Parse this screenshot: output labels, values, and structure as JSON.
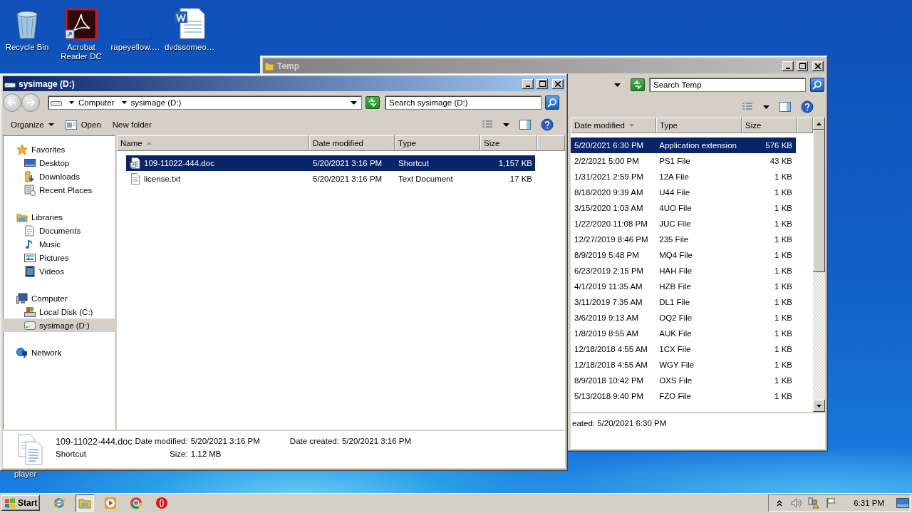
{
  "desktop": {
    "icons": [
      {
        "label": "Recycle Bin",
        "kind": "bin"
      },
      {
        "label": "Acrobat Reader DC",
        "kind": "acrobat"
      },
      {
        "label": "rapeyellow.…",
        "kind": "blank"
      },
      {
        "label": "dvdssomeo…",
        "kind": "word"
      }
    ],
    "covered_label": "player"
  },
  "temp_window": {
    "title": "Temp",
    "active": false,
    "search_placeholder": "Search Temp",
    "columns": [
      {
        "label": "Date modified",
        "sorted": true,
        "descending": true
      },
      {
        "label": "Type",
        "sorted": false
      },
      {
        "label": "Size",
        "sorted": false
      }
    ],
    "rows": [
      {
        "date": "5/20/2021 6:30 PM",
        "type": "Application extension",
        "size": "576 KB",
        "selected": true
      },
      {
        "date": "2/2/2021 5:00 PM",
        "type": "PS1 File",
        "size": "43 KB",
        "selected": false
      },
      {
        "date": "1/31/2021 2:59 PM",
        "type": "12A File",
        "size": "1 KB",
        "selected": false
      },
      {
        "date": "8/18/2020 9:39 AM",
        "type": "U44 File",
        "size": "1 KB",
        "selected": false
      },
      {
        "date": "3/15/2020 1:03 AM",
        "type": "4UO File",
        "size": "1 KB",
        "selected": false
      },
      {
        "date": "1/22/2020 11:08 PM",
        "type": "JUC File",
        "size": "1 KB",
        "selected": false
      },
      {
        "date": "12/27/2019 8:46 PM",
        "type": "235 File",
        "size": "1 KB",
        "selected": false
      },
      {
        "date": "8/9/2019 5:48 PM",
        "type": "MQ4 File",
        "size": "1 KB",
        "selected": false
      },
      {
        "date": "6/23/2019 2:15 PM",
        "type": "HAH File",
        "size": "1 KB",
        "selected": false
      },
      {
        "date": "4/1/2019 11:35 AM",
        "type": "HZB File",
        "size": "1 KB",
        "selected": false
      },
      {
        "date": "3/11/2019 7:35 AM",
        "type": "DL1 File",
        "size": "1 KB",
        "selected": false
      },
      {
        "date": "3/6/2019 9:13 AM",
        "type": "OQ2 File",
        "size": "1 KB",
        "selected": false
      },
      {
        "date": "1/8/2019 8:55 AM",
        "type": "AUK File",
        "size": "1 KB",
        "selected": false
      },
      {
        "date": "12/18/2018 4:55 AM",
        "type": "1CX File",
        "size": "1 KB",
        "selected": false
      },
      {
        "date": "12/18/2018 4:55 AM",
        "type": "WGY File",
        "size": "1 KB",
        "selected": false
      },
      {
        "date": "8/9/2018 10:42 PM",
        "type": "OXS File",
        "size": "1 KB",
        "selected": false
      },
      {
        "date": "5/13/2018 9:40 PM",
        "type": "FZO File",
        "size": "1 KB",
        "selected": false
      }
    ],
    "status": "eated: 5/20/2021 6:30 PM"
  },
  "explorer_window": {
    "title": "sysimage (D:)",
    "active": true,
    "breadcrumb": [
      "Computer",
      "sysimage (D:)"
    ],
    "search_placeholder": "Search sysimage (D:)",
    "commands": [
      {
        "label": "Organize",
        "kind": "menu"
      },
      {
        "label": "Open",
        "kind": "icon"
      },
      {
        "label": "New folder",
        "kind": "plain"
      }
    ],
    "nav": [
      {
        "label": "Favorites",
        "kind": "star",
        "selected": false,
        "children": [
          {
            "label": "Desktop",
            "kind": "desktop",
            "selected": false
          },
          {
            "label": "Downloads",
            "kind": "downloads",
            "selected": false
          },
          {
            "label": "Recent Places",
            "kind": "recent",
            "selected": false
          }
        ]
      },
      {
        "label": "Libraries",
        "kind": "libraries",
        "selected": false,
        "children": [
          {
            "label": "Documents",
            "kind": "documents",
            "selected": false
          },
          {
            "label": "Music",
            "kind": "music",
            "selected": false
          },
          {
            "label": "Pictures",
            "kind": "pictures",
            "selected": false
          },
          {
            "label": "Videos",
            "kind": "videos",
            "selected": false
          }
        ]
      },
      {
        "label": "Computer",
        "kind": "computer",
        "selected": false,
        "children": [
          {
            "label": "Local Disk (C:)",
            "kind": "localdisk",
            "selected": false
          },
          {
            "label": "sysimage (D:)",
            "kind": "drive",
            "selected": true
          }
        ]
      },
      {
        "label": "Network",
        "kind": "network",
        "selected": false
      }
    ],
    "columns": [
      {
        "label": "Name",
        "sorted": true,
        "descending": false
      },
      {
        "label": "Date modified",
        "sorted": false
      },
      {
        "label": "Type",
        "sorted": false
      },
      {
        "label": "Size",
        "sorted": false
      }
    ],
    "files": [
      {
        "name": "109-11022-444.doc",
        "date": "5/20/2021 3:16 PM",
        "type": "Shortcut",
        "size": "1,157 KB",
        "kind": "shortcut",
        "selected": true
      },
      {
        "name": "license.txt",
        "date": "5/20/2021 3:16 PM",
        "type": "Text Document",
        "size": "17 KB",
        "kind": "text",
        "selected": false
      }
    ],
    "details": {
      "name": "109-11022-444.doc",
      "type": "Shortcut",
      "fields": [
        {
          "label": "Date modified:",
          "value": "5/20/2021 3:16 PM"
        },
        {
          "label": "Size:",
          "value": "1.12 MB"
        },
        {
          "label": "Date created:",
          "value": "5/20/2021 3:16 PM"
        }
      ]
    }
  },
  "taskbar": {
    "start": "Start",
    "apps": [
      {
        "kind": "ie",
        "active": false
      },
      {
        "kind": "explorer",
        "active": true
      },
      {
        "kind": "media",
        "active": false
      },
      {
        "kind": "chrome",
        "active": false
      },
      {
        "kind": "opera",
        "active": false
      }
    ],
    "clock": "6:31 PM"
  }
}
